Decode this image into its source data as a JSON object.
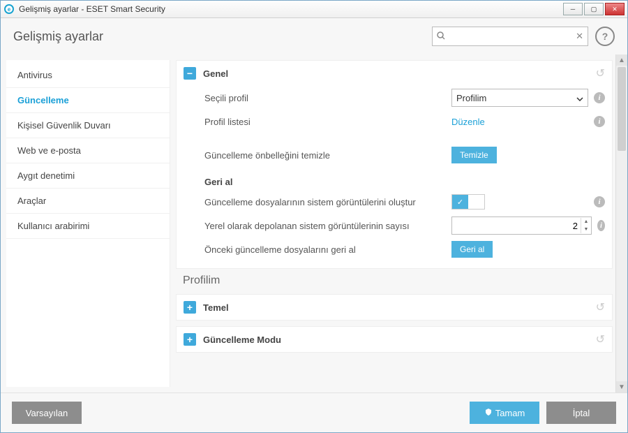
{
  "window": {
    "title": "Gelişmiş ayarlar - ESET Smart Security"
  },
  "header": {
    "page_title": "Gelişmiş ayarlar",
    "search_placeholder": ""
  },
  "sidebar": {
    "items": [
      {
        "label": "Antivirus"
      },
      {
        "label": "Güncelleme"
      },
      {
        "label": "Kişisel Güvenlik Duvarı"
      },
      {
        "label": "Web ve e-posta"
      },
      {
        "label": "Aygıt denetimi"
      },
      {
        "label": "Araçlar"
      },
      {
        "label": "Kullanıcı arabirimi"
      }
    ],
    "active_index": 1
  },
  "panels": {
    "general": {
      "title": "Genel",
      "selected_profile_label": "Seçili profil",
      "selected_profile_value": "Profilim",
      "profile_list_label": "Profil listesi",
      "profile_list_action": "Düzenle",
      "clear_cache_label": "Güncelleme önbelleğini temizle",
      "clear_cache_button": "Temizle",
      "rollback_subheader": "Geri al",
      "create_snapshots_label": "Güncelleme dosyalarının sistem görüntülerini oluştur",
      "snapshot_count_label": "Yerel olarak depolanan sistem görüntülerinin sayısı",
      "snapshot_count_value": "2",
      "rollback_files_label": "Önceki güncelleme dosyalarını geri al",
      "rollback_files_button": "Geri al"
    },
    "profile_header": "Profilim",
    "basic": {
      "title": "Temel"
    },
    "update_mode": {
      "title": "Güncelleme Modu"
    }
  },
  "footer": {
    "default": "Varsayılan",
    "ok": "Tamam",
    "cancel": "İptal"
  }
}
